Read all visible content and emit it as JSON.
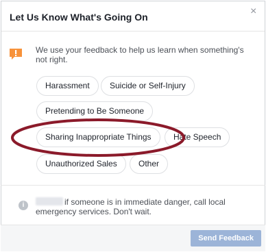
{
  "dialog": {
    "title": "Let Us Know What's Going On",
    "close_glyph": "×",
    "notice": {
      "icon": "exclamation-flag-icon",
      "text": "We use your feedback to help us learn when something's not right."
    },
    "options": [
      {
        "label": "Harassment"
      },
      {
        "label": "Suicide or Self-Injury"
      },
      {
        "label": "Pretending to Be Someone"
      },
      {
        "label": "Sharing Inappropriate Things",
        "highlighted": true
      },
      {
        "label": "Hate Speech"
      },
      {
        "label": "Unauthorized Sales"
      },
      {
        "label": "Other"
      }
    ],
    "help": {
      "icon": "info-icon",
      "text": "if someone is in immediate danger, call local emergency services. Don't wait."
    },
    "footer": {
      "send_label": "Send Feedback",
      "send_enabled": false
    }
  },
  "colors": {
    "annotation_ring": "#8b1a2a",
    "notice_icon": "#f7923a",
    "send_disabled": "#9cb4d8"
  }
}
